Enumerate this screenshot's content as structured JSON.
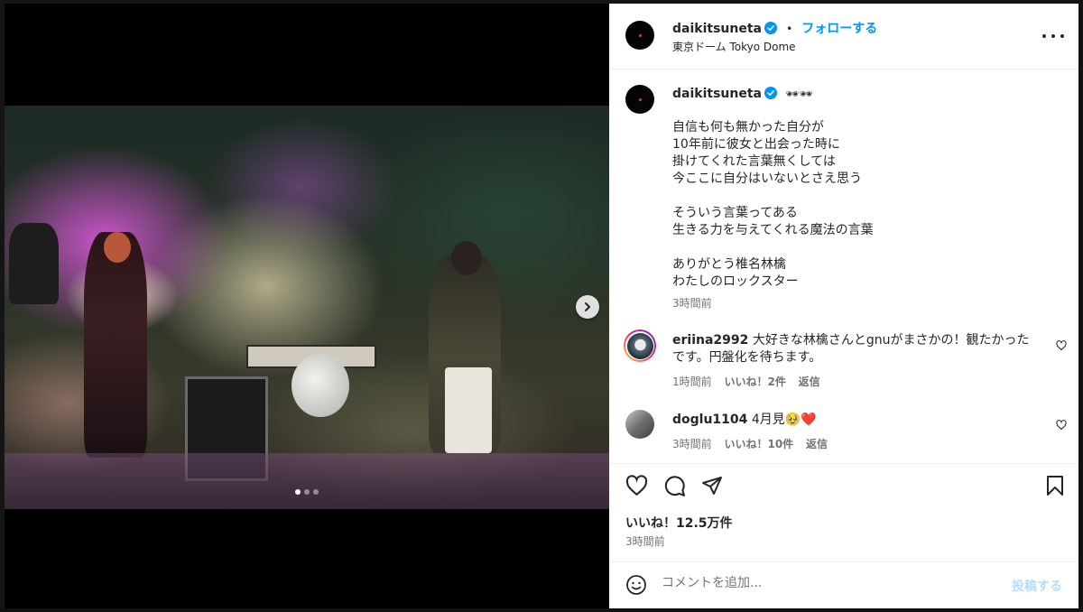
{
  "post": {
    "username": "daikitsuneta",
    "follow_label": "フォローする",
    "separator": "•",
    "location": "東京ドーム Tokyo Dome",
    "caption_emoji": "🕶🕶",
    "caption_lines": [
      "自信も何も無かった自分が",
      "10年前に彼女と出会った時に",
      "掛けてくれた言葉無くしては",
      "今ここに自分はいないとさえ思う",
      "",
      "そういう言葉ってある",
      "生きる力を与えてくれる魔法の言葉",
      "",
      "ありがとう椎名林檎",
      "わたしのロックスター"
    ],
    "caption_time": "3時間前",
    "likes": "いいね！12.5万件",
    "posted_time": "3時間前"
  },
  "comments": [
    {
      "username": "eriina2992",
      "text_line1": "大好きな林檎さんとgnuがまさかの！観たかった",
      "text_line2": "です。円盤化を待ちます。",
      "time": "1時間前",
      "likes": "いいね！2件",
      "reply": "返信"
    },
    {
      "username": "doglu1104",
      "text_line1": "4月見🥹❤️",
      "time": "3時間前",
      "likes": "いいね！10件",
      "reply": "返信"
    }
  ],
  "comment_box": {
    "placeholder": "コメントを追加...",
    "post_label": "投稿する"
  },
  "icons": {
    "verified": "verified-badge-icon",
    "more": "more-options-icon",
    "like": "heart-icon",
    "comment": "comment-icon",
    "share": "send-icon",
    "save": "bookmark-icon",
    "emoji": "emoji-icon",
    "next": "chevron-right-icon"
  },
  "colors": {
    "accent": "#0095f6",
    "verified": "#0095f6",
    "text": "#262626",
    "muted": "#737373",
    "post_disabled": "#b2dffc"
  },
  "carousel": {
    "slide_count": 3,
    "current_slide": 1
  }
}
